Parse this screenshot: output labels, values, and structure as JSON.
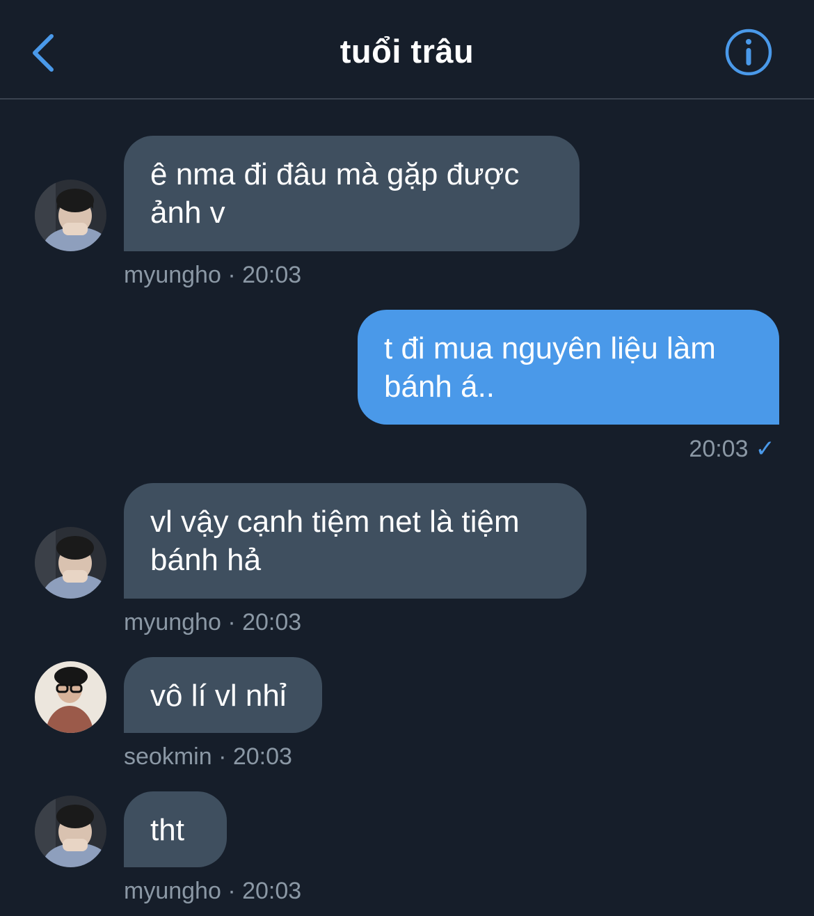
{
  "header": {
    "back_icon": "chevron-left-icon",
    "title": "tuổi trâu",
    "info_icon": "info-circle-icon",
    "accent": "#4a99e9"
  },
  "messages": [
    {
      "direction": "in",
      "text": "ê nma đi đâu mà gặp được ảnh v",
      "sender": "myungho",
      "time": "20:03",
      "separator": "·"
    },
    {
      "direction": "out",
      "text": "t đi mua nguyên liệu làm bánh á..",
      "time": "20:03",
      "status_icon": "checkmark-icon",
      "status_glyph": "✓"
    },
    {
      "direction": "in",
      "text": "vl vậy cạnh tiệm net là tiệm bánh hả",
      "sender": "myungho",
      "time": "20:03",
      "separator": "·"
    },
    {
      "direction": "in",
      "text": "vô lí vl nhỉ",
      "sender": "seokmin",
      "time": "20:03",
      "separator": "·"
    },
    {
      "direction": "in",
      "text": "tht",
      "sender": "myungho",
      "time": "20:03",
      "separator": "·"
    }
  ],
  "colors": {
    "background": "#161e2a",
    "incoming_bubble": "#3f4f5f",
    "outgoing_bubble": "#4a99e9",
    "meta_text": "#8b98a5"
  }
}
